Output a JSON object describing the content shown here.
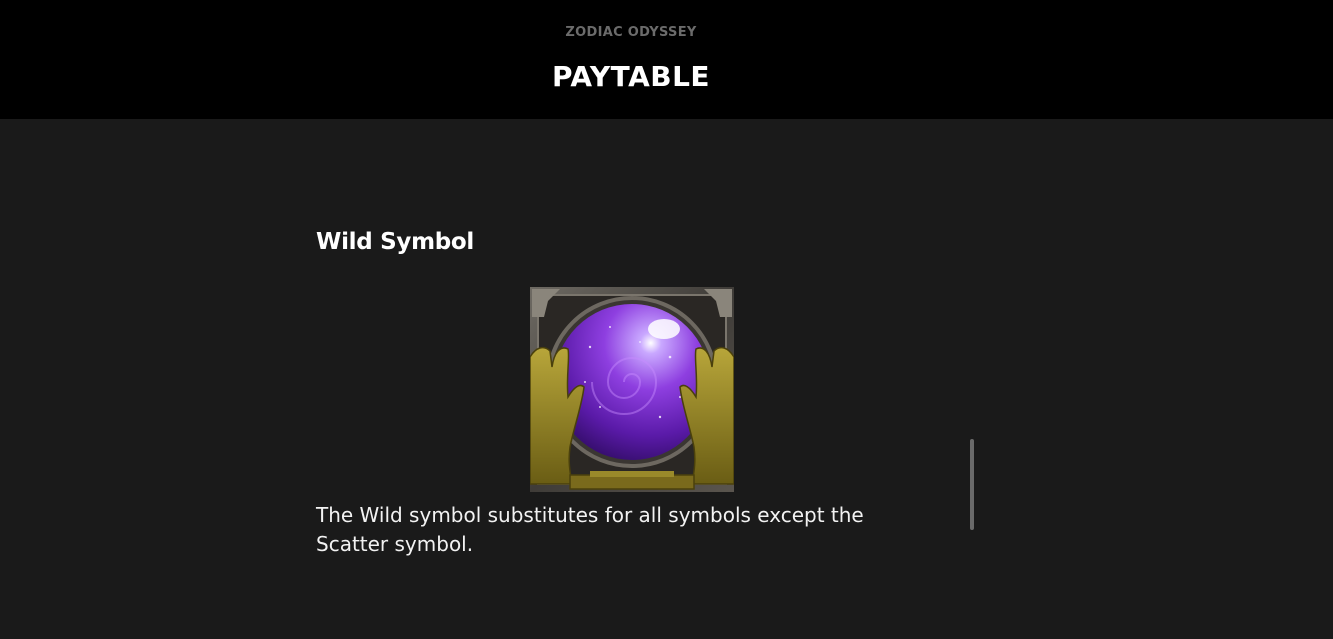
{
  "header": {
    "game_title": "ZODIAC ODYSSEY",
    "page_title": "PAYTABLE"
  },
  "section": {
    "heading": "Wild Symbol",
    "symbol_icon": "crystal-ball-wild-icon",
    "description": "The Wild symbol substitutes for all symbols except the Scatter symbol."
  },
  "colors": {
    "header_bg": "#000000",
    "content_bg": "#1a1a1a",
    "orb_purple": "#8a2be2",
    "hands_gold": "#8a7a1e"
  }
}
